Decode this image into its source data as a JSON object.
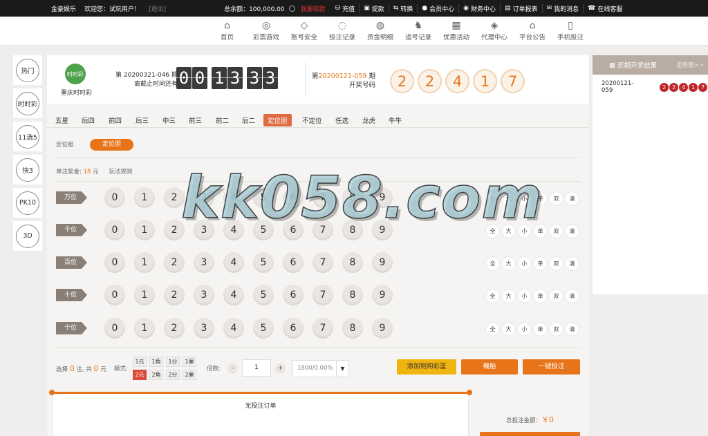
{
  "topbar": {
    "brand": "金豪娱乐",
    "welcome": "欢迎您：试玩用户！",
    "logout": "[退出]",
    "balance_label": "总余额：",
    "balance_value": "100,000.00",
    "stamp": "我要取款",
    "links": [
      {
        "icon": "gift-icon",
        "glyph": "⛁",
        "label": "充值"
      },
      {
        "icon": "wallet-icon",
        "glyph": "▣",
        "label": "提款"
      },
      {
        "icon": "swap-icon",
        "glyph": "⇆",
        "label": "转换"
      },
      {
        "icon": "user-icon",
        "glyph": "●",
        "label": "会员中心"
      },
      {
        "icon": "finance-icon",
        "glyph": "◉",
        "label": "财务中心"
      },
      {
        "icon": "report-icon",
        "glyph": "▤",
        "label": "订单报表"
      },
      {
        "icon": "mail-icon",
        "glyph": "✉",
        "label": "我的消息"
      },
      {
        "icon": "support-icon",
        "glyph": "☎",
        "label": "在线客服"
      }
    ]
  },
  "mainnav": [
    {
      "icon": "home-icon",
      "glyph": "⌂",
      "label": "首页"
    },
    {
      "icon": "lottery-icon",
      "glyph": "◎",
      "label": "彩票游戏"
    },
    {
      "icon": "shield-icon",
      "glyph": "◇",
      "label": "账号安全"
    },
    {
      "icon": "record-icon",
      "glyph": "◌",
      "label": "投注记录"
    },
    {
      "icon": "funds-icon",
      "glyph": "◍",
      "label": "资金明细"
    },
    {
      "icon": "chase-icon",
      "glyph": "♞",
      "label": "追号记录"
    },
    {
      "icon": "promo-icon",
      "glyph": "▦",
      "label": "优惠活动"
    },
    {
      "icon": "agent-icon",
      "glyph": "◈",
      "label": "代理中心"
    },
    {
      "icon": "announce-icon",
      "glyph": "⌂",
      "label": "平台公告"
    },
    {
      "icon": "mobile-icon",
      "glyph": "▯",
      "label": "手机投注"
    }
  ],
  "sidebar": [
    "热门",
    "时时彩",
    "11选5",
    "快3",
    "PK10",
    "3D"
  ],
  "game": {
    "logo_text": "时时彩",
    "name": "重庆时时彩",
    "issue_line": "第 20200321-046 期",
    "deadline_line": "离截止时间还有",
    "countdown": [
      "0",
      "0",
      "1",
      "3",
      "3",
      "3"
    ],
    "prev_issue_prefix": "第",
    "prev_issue": "20200121-059",
    "prev_issue_suffix": "期",
    "prev_label": "开奖号码",
    "draw_numbers": [
      "2",
      "2",
      "4",
      "1",
      "7"
    ]
  },
  "play_tabs": [
    "五星",
    "后四",
    "前四",
    "后三",
    "中三",
    "前三",
    "前二",
    "后二",
    "定位胆",
    "不定位",
    "任选",
    "龙虎",
    "牛牛"
  ],
  "active_tab": "定位胆",
  "subtype": {
    "label": "定位胆",
    "button": "定位胆"
  },
  "prize": {
    "label": "单注奖金:",
    "value": "18",
    "unit": "元",
    "rules": "玩法规则"
  },
  "rows": [
    {
      "label": "万位"
    },
    {
      "label": "千位"
    },
    {
      "label": "百位"
    },
    {
      "label": "十位"
    },
    {
      "label": "个位"
    }
  ],
  "digits": [
    "0",
    "1",
    "2",
    "3",
    "4",
    "5",
    "6",
    "7",
    "8",
    "9"
  ],
  "quick": [
    "全",
    "大",
    "小",
    "单",
    "双",
    "清"
  ],
  "bottom": {
    "select_prefix": "选择",
    "select_count": "0",
    "select_mid": "注, 共",
    "select_amount": "0",
    "select_suffix": "元",
    "mode_label": "模式:",
    "units_top": [
      "1元",
      "1角",
      "1分",
      "1厘"
    ],
    "units_bottom": [
      "2元",
      "2角",
      "2分",
      "2厘"
    ],
    "multiplier_label": "倍数:",
    "minus": "-",
    "plus": "+",
    "multiplier": "1",
    "rebate": "1800/0.00%",
    "add_cart": "添加到购彩篮",
    "random": "機胎",
    "quick_bet": "一键投注"
  },
  "orders": {
    "empty": "无投注订单",
    "total_label": "总投注金额：",
    "total_value": "￥0"
  },
  "recent": {
    "title": "近期开奖结果",
    "more": "走势图>>",
    "rows": [
      {
        "issue": "20200121-059",
        "balls": [
          "2",
          "2",
          "4",
          "1",
          "7"
        ]
      }
    ]
  },
  "watermark": "kk058.com",
  "colors": {
    "accent": "#e8741a",
    "active_tab": "#e06a42",
    "red_ball": "#c0272d",
    "add_cart": "#f0b40f",
    "green_logo": "#4da24a"
  }
}
